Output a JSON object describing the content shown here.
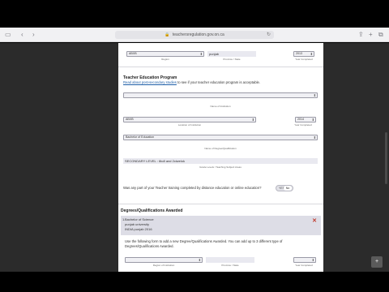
{
  "browser": {
    "url": "teachersregulation.gov.on.ca",
    "icons": [
      "sidebar-icon",
      "chevron-left-icon",
      "chevron-right-icon",
      "lock-icon",
      "reload-icon",
      "share-icon",
      "new-tab-icon",
      "tabs-icon"
    ]
  },
  "top_row": {
    "province_select": "ABXB",
    "province_input": "punjab",
    "province_caption": "Region",
    "state_caption": "Province / State",
    "year_select": "2013",
    "year_caption": "Year Completed"
  },
  "teacher_ed": {
    "heading": "Teacher Education Program",
    "link_text": "Read about post-secondary studies",
    "link_suffix": " to see if your teacher education program is acceptable.",
    "institution_caption": "Name of Institution",
    "country_select": "ABXB",
    "country_caption": "Location of Institution",
    "year_select": "2014",
    "year_caption": "Year Completed",
    "degree_select": "Bachelor of Education",
    "degree_caption": "Name of Degree/Qualification",
    "grade_input": "SECONDARY LEVEL : 6to8 and 2ciwelok",
    "grade_caption": "Grade Levels / Teaching Subject Areas",
    "distance_question": "Was any part of your Teacher training completed by distance education or online education?",
    "toggle_yes": "YES",
    "toggle_no": "No"
  },
  "degrees": {
    "heading": "Degrees/Qualifications Awarded",
    "entry": {
      "number": "1.",
      "line1": "Bachelor of Science",
      "line2": "punjab university",
      "line3": "INDIA punjab 2016"
    },
    "instructions": "Use the following form to add a new Degree/Qualifications Awarded. You can add up to 3 different type of Degrees/Qualifications Awarded.",
    "region_caption": "Region of Institution",
    "state_caption": "Province / State",
    "year_caption": "Year Completed"
  },
  "fab_label": "+"
}
